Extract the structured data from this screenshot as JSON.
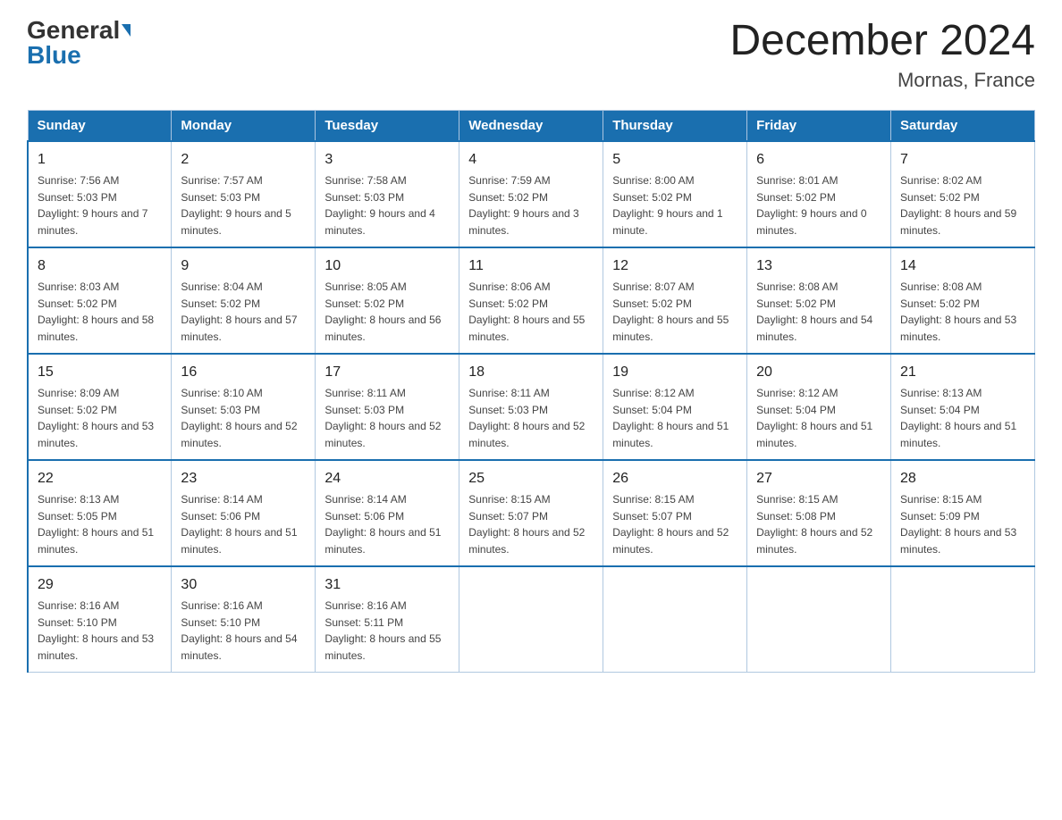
{
  "header": {
    "logo_general": "General",
    "logo_blue": "Blue",
    "month_title": "December 2024",
    "location": "Mornas, France"
  },
  "days_of_week": [
    "Sunday",
    "Monday",
    "Tuesday",
    "Wednesday",
    "Thursday",
    "Friday",
    "Saturday"
  ],
  "weeks": [
    [
      {
        "day": "1",
        "sunrise": "7:56 AM",
        "sunset": "5:03 PM",
        "daylight": "9 hours and 7 minutes."
      },
      {
        "day": "2",
        "sunrise": "7:57 AM",
        "sunset": "5:03 PM",
        "daylight": "9 hours and 5 minutes."
      },
      {
        "day": "3",
        "sunrise": "7:58 AM",
        "sunset": "5:03 PM",
        "daylight": "9 hours and 4 minutes."
      },
      {
        "day": "4",
        "sunrise": "7:59 AM",
        "sunset": "5:02 PM",
        "daylight": "9 hours and 3 minutes."
      },
      {
        "day": "5",
        "sunrise": "8:00 AM",
        "sunset": "5:02 PM",
        "daylight": "9 hours and 1 minute."
      },
      {
        "day": "6",
        "sunrise": "8:01 AM",
        "sunset": "5:02 PM",
        "daylight": "9 hours and 0 minutes."
      },
      {
        "day": "7",
        "sunrise": "8:02 AM",
        "sunset": "5:02 PM",
        "daylight": "8 hours and 59 minutes."
      }
    ],
    [
      {
        "day": "8",
        "sunrise": "8:03 AM",
        "sunset": "5:02 PM",
        "daylight": "8 hours and 58 minutes."
      },
      {
        "day": "9",
        "sunrise": "8:04 AM",
        "sunset": "5:02 PM",
        "daylight": "8 hours and 57 minutes."
      },
      {
        "day": "10",
        "sunrise": "8:05 AM",
        "sunset": "5:02 PM",
        "daylight": "8 hours and 56 minutes."
      },
      {
        "day": "11",
        "sunrise": "8:06 AM",
        "sunset": "5:02 PM",
        "daylight": "8 hours and 55 minutes."
      },
      {
        "day": "12",
        "sunrise": "8:07 AM",
        "sunset": "5:02 PM",
        "daylight": "8 hours and 55 minutes."
      },
      {
        "day": "13",
        "sunrise": "8:08 AM",
        "sunset": "5:02 PM",
        "daylight": "8 hours and 54 minutes."
      },
      {
        "day": "14",
        "sunrise": "8:08 AM",
        "sunset": "5:02 PM",
        "daylight": "8 hours and 53 minutes."
      }
    ],
    [
      {
        "day": "15",
        "sunrise": "8:09 AM",
        "sunset": "5:02 PM",
        "daylight": "8 hours and 53 minutes."
      },
      {
        "day": "16",
        "sunrise": "8:10 AM",
        "sunset": "5:03 PM",
        "daylight": "8 hours and 52 minutes."
      },
      {
        "day": "17",
        "sunrise": "8:11 AM",
        "sunset": "5:03 PM",
        "daylight": "8 hours and 52 minutes."
      },
      {
        "day": "18",
        "sunrise": "8:11 AM",
        "sunset": "5:03 PM",
        "daylight": "8 hours and 52 minutes."
      },
      {
        "day": "19",
        "sunrise": "8:12 AM",
        "sunset": "5:04 PM",
        "daylight": "8 hours and 51 minutes."
      },
      {
        "day": "20",
        "sunrise": "8:12 AM",
        "sunset": "5:04 PM",
        "daylight": "8 hours and 51 minutes."
      },
      {
        "day": "21",
        "sunrise": "8:13 AM",
        "sunset": "5:04 PM",
        "daylight": "8 hours and 51 minutes."
      }
    ],
    [
      {
        "day": "22",
        "sunrise": "8:13 AM",
        "sunset": "5:05 PM",
        "daylight": "8 hours and 51 minutes."
      },
      {
        "day": "23",
        "sunrise": "8:14 AM",
        "sunset": "5:06 PM",
        "daylight": "8 hours and 51 minutes."
      },
      {
        "day": "24",
        "sunrise": "8:14 AM",
        "sunset": "5:06 PM",
        "daylight": "8 hours and 51 minutes."
      },
      {
        "day": "25",
        "sunrise": "8:15 AM",
        "sunset": "5:07 PM",
        "daylight": "8 hours and 52 minutes."
      },
      {
        "day": "26",
        "sunrise": "8:15 AM",
        "sunset": "5:07 PM",
        "daylight": "8 hours and 52 minutes."
      },
      {
        "day": "27",
        "sunrise": "8:15 AM",
        "sunset": "5:08 PM",
        "daylight": "8 hours and 52 minutes."
      },
      {
        "day": "28",
        "sunrise": "8:15 AM",
        "sunset": "5:09 PM",
        "daylight": "8 hours and 53 minutes."
      }
    ],
    [
      {
        "day": "29",
        "sunrise": "8:16 AM",
        "sunset": "5:10 PM",
        "daylight": "8 hours and 53 minutes."
      },
      {
        "day": "30",
        "sunrise": "8:16 AM",
        "sunset": "5:10 PM",
        "daylight": "8 hours and 54 minutes."
      },
      {
        "day": "31",
        "sunrise": "8:16 AM",
        "sunset": "5:11 PM",
        "daylight": "8 hours and 55 minutes."
      },
      null,
      null,
      null,
      null
    ]
  ]
}
